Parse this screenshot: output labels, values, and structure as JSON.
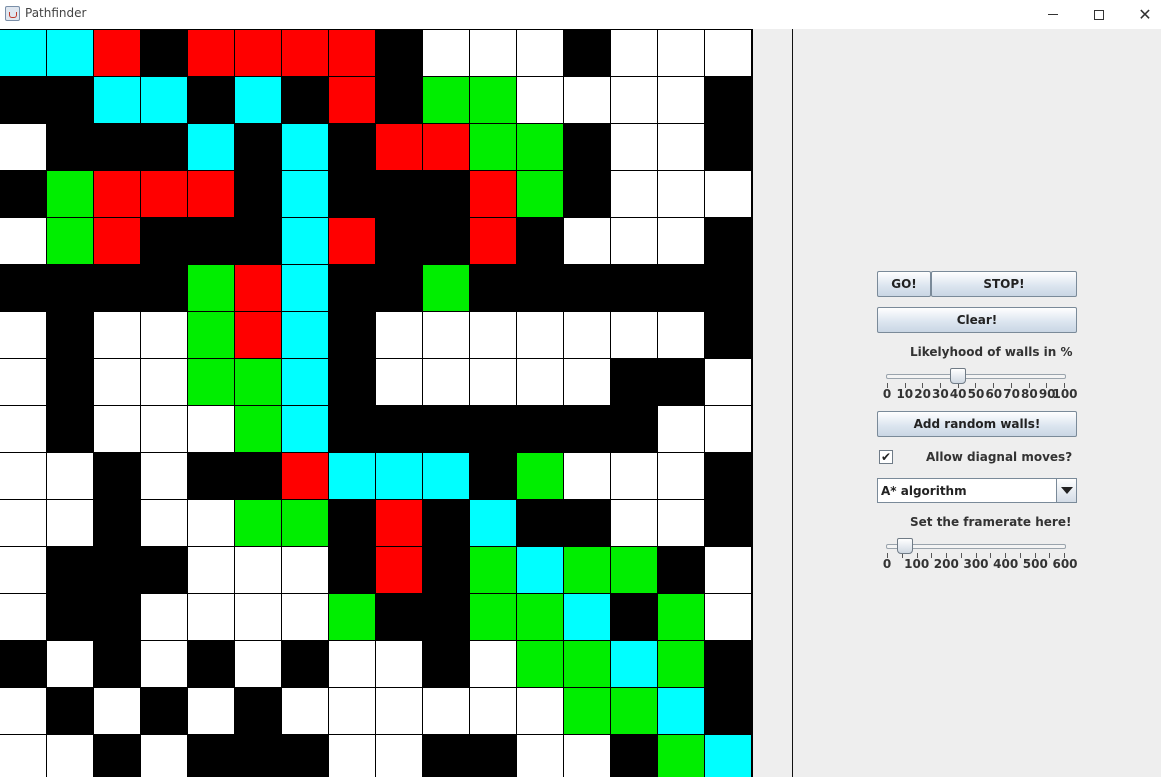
{
  "window": {
    "title": "Pathfinder"
  },
  "grid": {
    "rows": [
      "ccrbrrrrbwwwbwww",
      "bbccbcbrbggwwwwb",
      "wbbbcbcbrrggbwwb",
      "bgrrrbcbbbrgbwww",
      "wgrbbbcrbbrbwwwb",
      "bbbbgrcbbgbbbbbb",
      "wbwwgrcbwwwwwwwb",
      "wbwwggcbwwwwwbbw",
      "wbwwwgcbbbbbbbww",
      "wwbwbbrcccbgwwwb",
      "wwbwwggbrbcbbwwb",
      "wbbbwwwbrbgcggbw",
      "wbbwwwwgbbggcbgw",
      "bwbwbwbwwbwggcgb",
      "wbwbwbwwwwwwggcb",
      "wwbwbbbwwbbwwbgc"
    ]
  },
  "controls": {
    "go_label": "GO!",
    "stop_label": "STOP!",
    "clear_label": "Clear!",
    "walls_label": "Likelyhood of walls in %",
    "walls_slider": {
      "value": 40,
      "min": 0,
      "max": 100,
      "tick_labels": [
        "0",
        "10",
        "20",
        "30",
        "40",
        "50",
        "60",
        "70",
        "80",
        "90",
        "100"
      ]
    },
    "add_walls_label": "Add random walls!",
    "diagonal": {
      "label": "Allow diagnal moves?",
      "checked": true
    },
    "algorithm": {
      "selected": "A* algorithm"
    },
    "fps_label": "Set the framerate here!",
    "fps_slider": {
      "value": 60,
      "min": 0,
      "max": 600,
      "tick_labels": [
        "0",
        "100",
        "200",
        "300",
        "400",
        "500",
        "600"
      ]
    }
  },
  "colors": {
    "wall": "#000000",
    "empty": "#ffffff",
    "closed": "#ff0000",
    "open": "#00ee00",
    "path": "#00ffff"
  }
}
